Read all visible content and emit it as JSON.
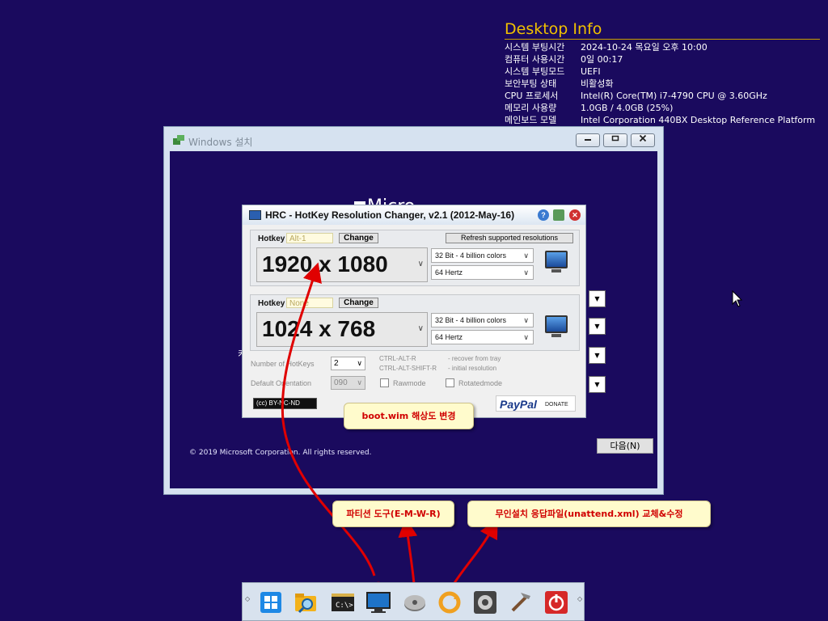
{
  "desktop_info": {
    "title": "Desktop Info",
    "rows": [
      {
        "key": "시스템 부팅시간",
        "value": "2024-10-24 목요일 오후 10:00"
      },
      {
        "key": "컴퓨터 사용시간",
        "value": "0일 00:17"
      },
      {
        "key": "시스템 부팅모드",
        "value": "UEFI"
      },
      {
        "key": "보안부팅 상태",
        "value": "비활성화"
      },
      {
        "key": "CPU 프로세서",
        "value": "Intel(R) Core(TM) i7-4790 CPU @ 3.60GHz"
      },
      {
        "key": "메모리 사용량",
        "value": "1.0GB / 4.0GB (25%)"
      },
      {
        "key": "메인보드 모델",
        "value": "Intel Corporation 440BX Desktop Reference Platform"
      }
    ]
  },
  "setup_window": {
    "title": "Windows 설치",
    "logo_text": "Micro",
    "stray_char": "키",
    "copyright": "© 2019 Microsoft Corporation. All rights reserved.",
    "next_label": "다음(N)",
    "dropdown_arrow": "▼"
  },
  "hrc": {
    "title": "HRC - HotKey Resolution Changer, v2.1 (2012-May-16)",
    "hotkey_label": "Hotkey",
    "change_label": "Change",
    "refresh_label": "Refresh supported resolutions",
    "group1": {
      "hotkey": "Alt-1",
      "resolution": "1920 x 1080",
      "color_depth": "32 Bit - 4 billion colors",
      "refresh": "64 Hertz"
    },
    "group2": {
      "hotkey": "None",
      "resolution": "1024 x 768",
      "color_depth": "32 Bit - 4 billion colors",
      "refresh": "64 Hertz"
    },
    "number_of_hotkeys_label": "Number of HotKeys",
    "number_of_hotkeys": "2",
    "default_orientation_label": "Default Orientation",
    "default_orientation": "090",
    "shortcut1": "CTRL-ALT-R",
    "shortcut1_desc": "- recover from tray",
    "shortcut2": "CTRL-ALT-SHIFT-R",
    "shortcut2_desc": "- initial resolution",
    "rawmode": "Rawmode",
    "rotatedmode": "Rotatedmode",
    "license": "(cc) BY-NC-ND",
    "paypal": "PayPal",
    "donate": "DONATE"
  },
  "callouts": {
    "bootwim": "boot.wim 해상도 변경",
    "partition": "파티션 도구(E-M-W-R)",
    "unattend": "무인설치 응답파일(unattend.xml) 교체&수정"
  },
  "taskbar": {
    "left_arrow": "◇",
    "right_arrow": "◇",
    "items": [
      "windows-start",
      "file-search",
      "command-prompt",
      "monitor-resolution",
      "disk-tool",
      "refresh-sync",
      "settings-gear",
      "build-tools",
      "power"
    ]
  },
  "colors": {
    "desktop_bg": "#1a0a5e",
    "accent_title": "#f0c000",
    "callout_text": "#d00000",
    "arrow_red": "#e00000"
  }
}
